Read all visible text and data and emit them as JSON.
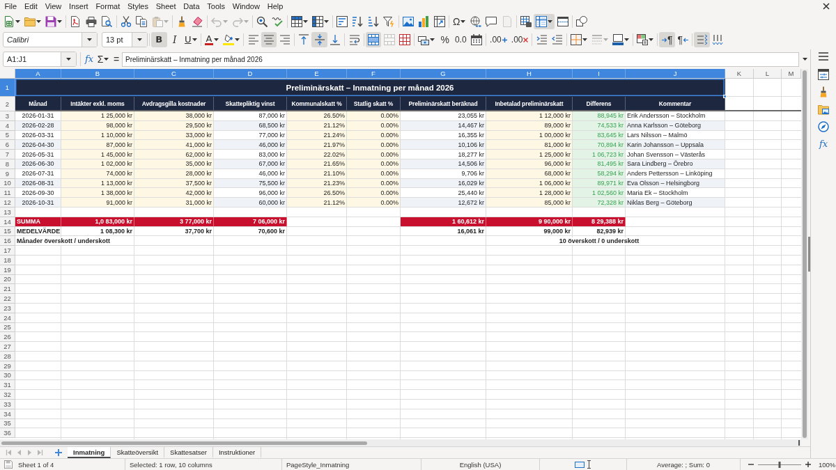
{
  "menu": [
    "File",
    "Edit",
    "View",
    "Insert",
    "Format",
    "Styles",
    "Sheet",
    "Data",
    "Tools",
    "Window",
    "Help"
  ],
  "standard_toolbar": {
    "paste_disabled": true,
    "undo_disabled": true,
    "redo_disabled": true,
    "special_character": "Ω",
    "header_footer_disabled": true,
    "freeze_on": true
  },
  "formatting_toolbar": {
    "font_name": "Calibri",
    "font_size": "13 pt",
    "bold": {
      "label": "B",
      "on": true
    },
    "italic": {
      "label": "I",
      "on": false
    },
    "underline": {
      "label": "U",
      "on": false
    },
    "font_color_label": "A",
    "align_left": false,
    "align_center": true,
    "align_right": false,
    "align_top": false,
    "align_middle": true,
    "align_bottom": false,
    "wrap_text": false,
    "merge_and_center": true,
    "merge_cells_disabled": true,
    "percent_format": "%",
    "number_format": "0.0",
    "add_decimal": ".00",
    "delete_decimal": ".00",
    "border_style_disabled": true,
    "paragraph_direction": [
      {
        "label": "¶",
        "selected": true
      },
      {
        "label": "¶",
        "selected": false
      }
    ],
    "text_horizontal": true,
    "text_vertical": false
  },
  "formula_bar": {
    "name_box": "A1:J1",
    "function_wizard": "fx",
    "sum": "Σ",
    "formula": "=",
    "content": "Preliminärskatt – Inmatning per månad 2026"
  },
  "sidebar": {
    "functions": "fx"
  },
  "sheet": {
    "columns": [
      {
        "letter": "A",
        "selected": true,
        "kind": "key"
      },
      {
        "letter": "B",
        "selected": true,
        "kind": "input"
      },
      {
        "letter": "C",
        "selected": true,
        "kind": "input"
      },
      {
        "letter": "D",
        "selected": true,
        "kind": "computed"
      },
      {
        "letter": "E",
        "selected": true,
        "kind": "input"
      },
      {
        "letter": "F",
        "selected": true,
        "kind": "input"
      },
      {
        "letter": "G",
        "selected": true,
        "kind": "computed"
      },
      {
        "letter": "H",
        "selected": true,
        "kind": "input"
      },
      {
        "letter": "I",
        "selected": true,
        "kind": "difference"
      },
      {
        "letter": "J",
        "selected": true,
        "kind": "note"
      },
      {
        "letter": "K",
        "selected": false,
        "kind": "none"
      },
      {
        "letter": "L",
        "selected": false,
        "kind": "none"
      },
      {
        "letter": "M",
        "selected": false,
        "kind": "none"
      }
    ],
    "rows": [
      {
        "number": "1",
        "selected": true,
        "kind": "title",
        "cells": {
          "A": "Preliminärskatt – Inmatning per månad 2026"
        }
      },
      {
        "number": "2",
        "selected": false,
        "kind": "header",
        "cells": {
          "A": "Månad",
          "B": "Intäkter exkl. moms",
          "C": "Avdragsgilla kostnader",
          "D": "Skattepliktig vinst",
          "E": "Kommunalskatt %",
          "F": "Statlig skatt %",
          "G": "Preliminärskatt beräknad",
          "H": "Inbetalad preliminärskatt",
          "I": "Differens",
          "J": "Kommentar"
        }
      },
      {
        "number": "3",
        "selected": false,
        "kind": "data",
        "banded": false,
        "cells": {
          "A": "2026-01-31",
          "B": "1 25,000 kr",
          "C": "38,000 kr",
          "D": "87,000 kr",
          "E": "26.50%",
          "F": "0.00%",
          "G": "23,055 kr",
          "H": "1 12,000 kr",
          "I": "88,945 kr",
          "J": "Erik Andersson – Stockholm"
        }
      },
      {
        "number": "4",
        "selected": false,
        "kind": "data",
        "banded": true,
        "cells": {
          "A": "2026-02-28",
          "B": "98,000 kr",
          "C": "29,500 kr",
          "D": "68,500 kr",
          "E": "21.12%",
          "F": "0.00%",
          "G": "14,467 kr",
          "H": "89,000 kr",
          "I": "74,533 kr",
          "J": "Anna Karlsson – Göteborg"
        }
      },
      {
        "number": "5",
        "selected": false,
        "kind": "data",
        "banded": false,
        "cells": {
          "A": "2026-03-31",
          "B": "1 10,000 kr",
          "C": "33,000 kr",
          "D": "77,000 kr",
          "E": "21.24%",
          "F": "0.00%",
          "G": "16,355 kr",
          "H": "1 00,000 kr",
          "I": "83,645 kr",
          "J": "Lars Nilsson – Malmö"
        }
      },
      {
        "number": "6",
        "selected": false,
        "kind": "data",
        "banded": true,
        "cells": {
          "A": "2026-04-30",
          "B": "87,000 kr",
          "C": "41,000 kr",
          "D": "46,000 kr",
          "E": "21.97%",
          "F": "0.00%",
          "G": "10,106 kr",
          "H": "81,000 kr",
          "I": "70,894 kr",
          "J": "Karin Johansson – Uppsala"
        }
      },
      {
        "number": "7",
        "selected": false,
        "kind": "data",
        "banded": false,
        "cells": {
          "A": "2026-05-31",
          "B": "1 45,000 kr",
          "C": "62,000 kr",
          "D": "83,000 kr",
          "E": "22.02%",
          "F": "0.00%",
          "G": "18,277 kr",
          "H": "1 25,000 kr",
          "I": "1 06,723 kr",
          "J": "Johan Svensson – Västerås"
        }
      },
      {
        "number": "8",
        "selected": false,
        "kind": "data",
        "banded": true,
        "cells": {
          "A": "2026-06-30",
          "B": "1 02,000 kr",
          "C": "35,000 kr",
          "D": "67,000 kr",
          "E": "21.65%",
          "F": "0.00%",
          "G": "14,506 kr",
          "H": "96,000 kr",
          "I": "81,495 kr",
          "J": "Sara Lindberg – Örebro"
        }
      },
      {
        "number": "9",
        "selected": false,
        "kind": "data",
        "banded": false,
        "cells": {
          "A": "2026-07-31",
          "B": "74,000 kr",
          "C": "28,000 kr",
          "D": "46,000 kr",
          "E": "21.10%",
          "F": "0.00%",
          "G": "9,706 kr",
          "H": "68,000 kr",
          "I": "58,294 kr",
          "J": "Anders Pettersson – Linköping"
        }
      },
      {
        "number": "10",
        "selected": false,
        "kind": "data",
        "banded": true,
        "cells": {
          "A": "2026-08-31",
          "B": "1 13,000 kr",
          "C": "37,500 kr",
          "D": "75,500 kr",
          "E": "21.23%",
          "F": "0.00%",
          "G": "16,029 kr",
          "H": "1 06,000 kr",
          "I": "89,971 kr",
          "J": "Eva Olsson – Helsingborg"
        }
      },
      {
        "number": "11",
        "selected": false,
        "kind": "data",
        "banded": false,
        "cells": {
          "A": "2026-09-30",
          "B": "1 38,000 kr",
          "C": "42,000 kr",
          "D": "96,000 kr",
          "E": "26.50%",
          "F": "0.00%",
          "G": "25,440 kr",
          "H": "1 28,000 kr",
          "I": "1 02,560 kr",
          "J": "Maria Ek – Stockholm"
        }
      },
      {
        "number": "12",
        "selected": false,
        "kind": "data",
        "banded": true,
        "cells": {
          "A": "2026-10-31",
          "B": "91,000 kr",
          "C": "31,000 kr",
          "D": "60,000 kr",
          "E": "21.12%",
          "F": "0.00%",
          "G": "12,672 kr",
          "H": "85,000 kr",
          "I": "72,328 kr",
          "J": "Niklas Berg – Göteborg"
        }
      },
      {
        "number": "13",
        "selected": false,
        "kind": "blank"
      },
      {
        "number": "14",
        "selected": false,
        "kind": "total",
        "cells": {
          "A": "SUMMA",
          "B": "1,0 83,000 kr",
          "C": "3 77,000 kr",
          "D": "7 06,000 kr",
          "G": "1 60,612 kr",
          "H": "9 90,000 kr",
          "I": "8 29,388 kr"
        }
      },
      {
        "number": "15",
        "selected": false,
        "kind": "average",
        "cells": {
          "A": "MEDELVÄRDE",
          "B": "1 08,300 kr",
          "C": "37,700 kr",
          "D": "70,600 kr",
          "G": "16,061 kr",
          "H": "99,000 kr",
          "I": "82,939 kr"
        }
      },
      {
        "number": "16",
        "selected": false,
        "kind": "note",
        "cells": {
          "A": "Månader överskott / underskott",
          "I": "10 överskott / 0 underskott"
        }
      },
      {
        "number": "17",
        "selected": false,
        "kind": "blank"
      },
      {
        "number": "18",
        "selected": false,
        "kind": "blank"
      },
      {
        "number": "19",
        "selected": false,
        "kind": "blank"
      },
      {
        "number": "20",
        "selected": false,
        "kind": "blank"
      },
      {
        "number": "21",
        "selected": false,
        "kind": "blank"
      },
      {
        "number": "22",
        "selected": false,
        "kind": "blank"
      },
      {
        "number": "23",
        "selected": false,
        "kind": "blank"
      },
      {
        "number": "24",
        "selected": false,
        "kind": "blank"
      },
      {
        "number": "25",
        "selected": false,
        "kind": "blank"
      },
      {
        "number": "26",
        "selected": false,
        "kind": "blank"
      },
      {
        "number": "27",
        "selected": false,
        "kind": "blank"
      },
      {
        "number": "28",
        "selected": false,
        "kind": "blank"
      },
      {
        "number": "29",
        "selected": false,
        "kind": "blank"
      },
      {
        "number": "30",
        "selected": false,
        "kind": "blank"
      },
      {
        "number": "31",
        "selected": false,
        "kind": "blank"
      },
      {
        "number": "32",
        "selected": false,
        "kind": "blank"
      },
      {
        "number": "33",
        "selected": false,
        "kind": "blank"
      },
      {
        "number": "34",
        "selected": false,
        "kind": "blank"
      },
      {
        "number": "35",
        "selected": false,
        "kind": "blank"
      },
      {
        "number": "36",
        "selected": false,
        "kind": "blank"
      }
    ]
  },
  "sheet_tab_bar": {
    "navigation_disabled": true,
    "tabs": [
      {
        "label": "Inmatning",
        "selected": true
      },
      {
        "label": "Skatteöversikt",
        "selected": false
      },
      {
        "label": "Skattesatser",
        "selected": false
      },
      {
        "label": "Instruktioner",
        "selected": false
      }
    ]
  },
  "status_bar": {
    "sheet": "Sheet 1 of 4",
    "selection": "Selected: 1 row, 10 columns",
    "page_style": "PageStyle_Inmatning",
    "language": "English (USA)",
    "statistics": "Average: ; Sum: 0",
    "zoom": {
      "level": 0.5,
      "reading": "100%"
    }
  }
}
